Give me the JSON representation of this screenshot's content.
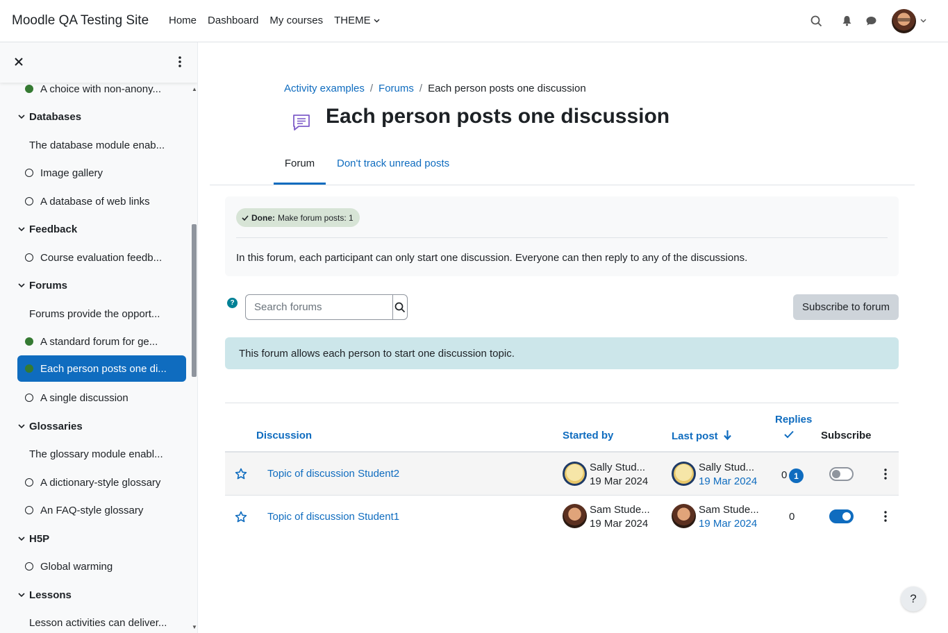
{
  "navbar": {
    "brand": "Moodle QA Testing Site",
    "links": [
      "Home",
      "Dashboard",
      "My courses"
    ],
    "theme_label": "THEME"
  },
  "drawer": {
    "items": [
      {
        "type": "activity",
        "label": "A choice with non-anony...",
        "status": "done"
      },
      {
        "type": "section",
        "label": "Databases"
      },
      {
        "type": "summary",
        "label": "The database module enab..."
      },
      {
        "type": "activity",
        "label": "Image gallery",
        "status": "todo"
      },
      {
        "type": "activity",
        "label": "A database of web links",
        "status": "todo"
      },
      {
        "type": "section",
        "label": "Feedback"
      },
      {
        "type": "activity",
        "label": "Course evaluation feedb...",
        "status": "todo"
      },
      {
        "type": "section",
        "label": "Forums"
      },
      {
        "type": "summary",
        "label": "Forums provide the opport..."
      },
      {
        "type": "activity",
        "label": "A standard forum for ge...",
        "status": "done"
      },
      {
        "type": "activity",
        "label": "Each person posts one di...",
        "status": "done",
        "active": true
      },
      {
        "type": "activity",
        "label": "A single discussion",
        "status": "todo"
      },
      {
        "type": "section",
        "label": "Glossaries"
      },
      {
        "type": "summary",
        "label": "The glossary module enabl..."
      },
      {
        "type": "activity",
        "label": "A dictionary-style glossary",
        "status": "todo"
      },
      {
        "type": "activity",
        "label": "An FAQ-style glossary",
        "status": "todo"
      },
      {
        "type": "section",
        "label": "H5P"
      },
      {
        "type": "activity",
        "label": "Global warming",
        "status": "todo"
      },
      {
        "type": "section",
        "label": "Lessons"
      },
      {
        "type": "summary",
        "label": "Lesson activities can deliver..."
      }
    ]
  },
  "breadcrumb": {
    "items": [
      "Activity examples",
      "Forums"
    ],
    "current": "Each person posts one discussion"
  },
  "page_title": "Each person posts one discussion",
  "tabs": {
    "forum": "Forum",
    "track": "Don't track unread posts"
  },
  "completion": {
    "done_label": "Done:",
    "done_text": "Make forum posts: 1"
  },
  "intro": "In this forum, each participant can only start one discussion. Everyone can then reply to any of the discussions.",
  "search": {
    "placeholder": "Search forums"
  },
  "subscribe_button": "Subscribe to forum",
  "alert": "This forum allows each person to start one discussion topic.",
  "table": {
    "headers": {
      "discussion": "Discussion",
      "started_by": "Started by",
      "last_post": "Last post",
      "replies": "Replies",
      "subscribe": "Subscribe"
    },
    "rows": [
      {
        "topic": "Topic of discussion Student2",
        "starter_name": "Sally Stud...",
        "starter_date": "19 Mar 2024",
        "last_name": "Sally Stud...",
        "last_date": "19 Mar 2024",
        "replies": "0",
        "unread": "1",
        "subscribed": false
      },
      {
        "topic": "Topic of discussion Student1",
        "starter_name": "Sam Stude...",
        "starter_date": "19 Mar 2024",
        "last_name": "Sam Stude...",
        "last_date": "19 Mar 2024",
        "replies": "0",
        "subscribed": true
      }
    ]
  },
  "help_fab": "?",
  "colors": {
    "accent": "#0f6cbf",
    "done": "#357a32",
    "info": "#cce6ea"
  }
}
